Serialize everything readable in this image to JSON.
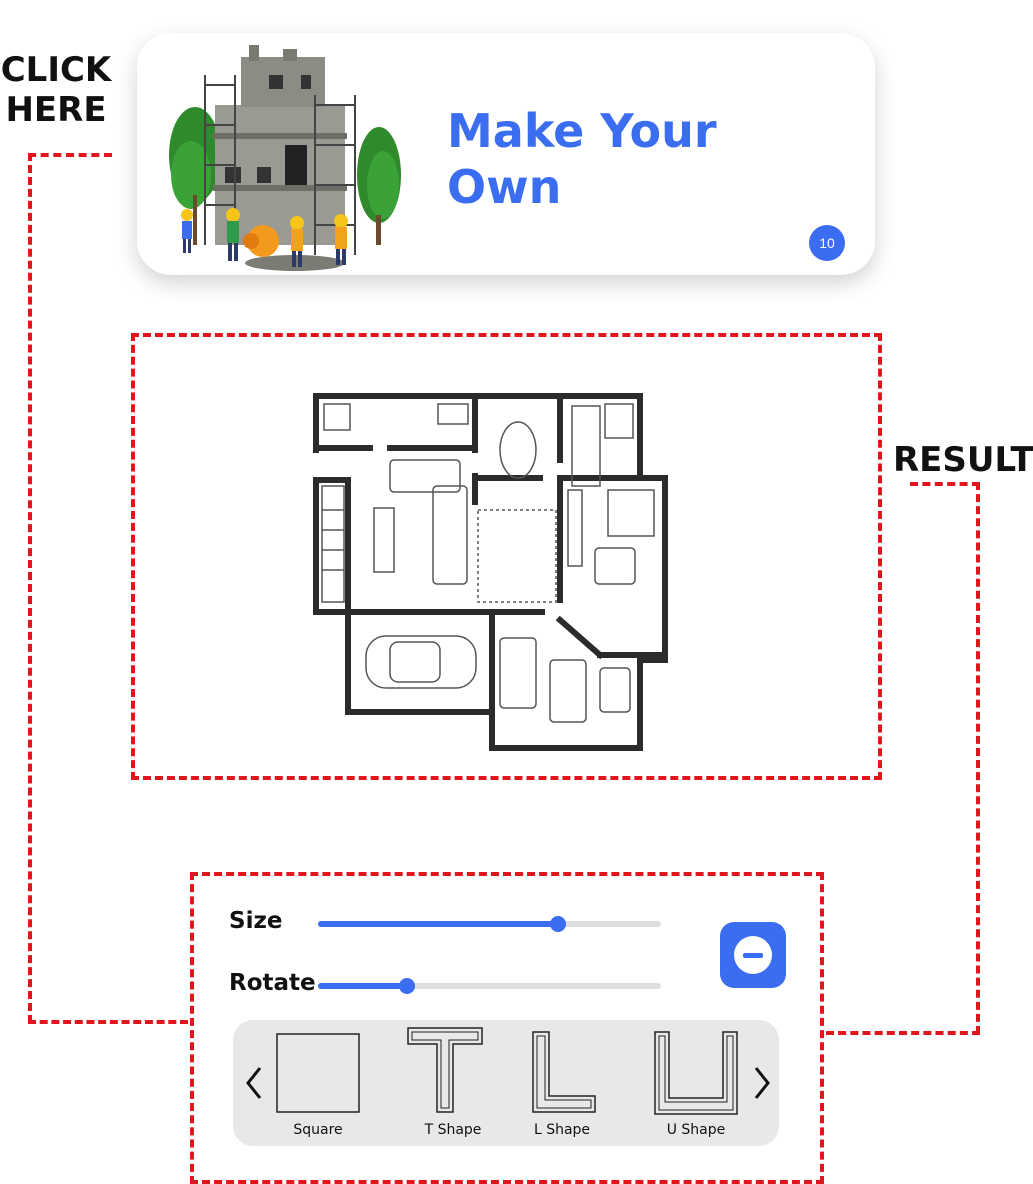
{
  "callouts": {
    "click_here": "CLICK\nHERE",
    "result": "RESULT"
  },
  "card": {
    "title": "Make Your Own",
    "badge": "10",
    "accent": "#3a6df0"
  },
  "controls": {
    "size": {
      "label": "Size",
      "value": 0.7
    },
    "rotate": {
      "label": "Rotate",
      "value": 0.26
    },
    "remove_icon": "minus-circle-icon"
  },
  "shapes": {
    "prev_icon": "chevron-left-icon",
    "next_icon": "chevron-right-icon",
    "items": [
      {
        "label": "Square",
        "icon": "square-shape-icon"
      },
      {
        "label": "T Shape",
        "icon": "t-shape-icon"
      },
      {
        "label": "L Shape",
        "icon": "l-shape-icon"
      },
      {
        "label": "U Shape",
        "icon": "u-shape-icon"
      }
    ]
  },
  "colors": {
    "dash": "#e0161c",
    "accent": "#3a6df0",
    "panel": "#e8e8e8"
  }
}
